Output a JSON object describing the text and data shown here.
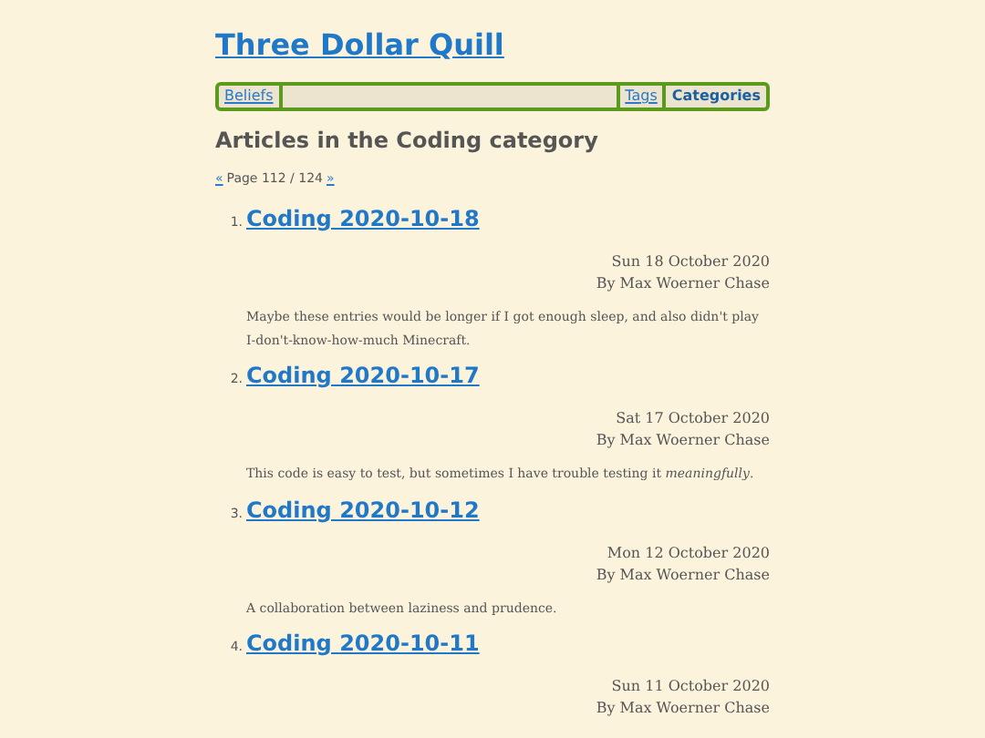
{
  "site_title": "Three Dollar Quill",
  "nav": {
    "left": [
      {
        "label": "Beliefs",
        "selected": false
      }
    ],
    "right": [
      {
        "label": "Tags",
        "selected": false
      },
      {
        "label": "Categories",
        "selected": true
      }
    ]
  },
  "heading": "Articles in the Coding category",
  "pager": {
    "prev": "«",
    "text": "Page 112 / 124",
    "next": "»"
  },
  "articles": [
    {
      "number": "1.",
      "title": "Coding 2020-10-18",
      "date": "Sun 18 October 2020",
      "author": "By Max Woerner Chase",
      "summary": "Maybe these entries would be longer if I got enough sleep, and also didn't play I-don't-know-how-much Minecraft."
    },
    {
      "number": "2.",
      "title": "Coding 2020-10-17",
      "date": "Sat 17 October 2020",
      "author": "By Max Woerner Chase",
      "summary": "This code is easy to test, but sometimes I have trouble testing it *meaningfully*."
    },
    {
      "number": "3.",
      "title": "Coding 2020-10-12",
      "date": "Mon 12 October 2020",
      "author": "By Max Woerner Chase",
      "summary": "A collaboration between laziness and prudence."
    },
    {
      "number": "4.",
      "title": "Coding 2020-10-11",
      "date": "Sun 11 October 2020",
      "author": "By Max Woerner Chase"
    }
  ]
}
